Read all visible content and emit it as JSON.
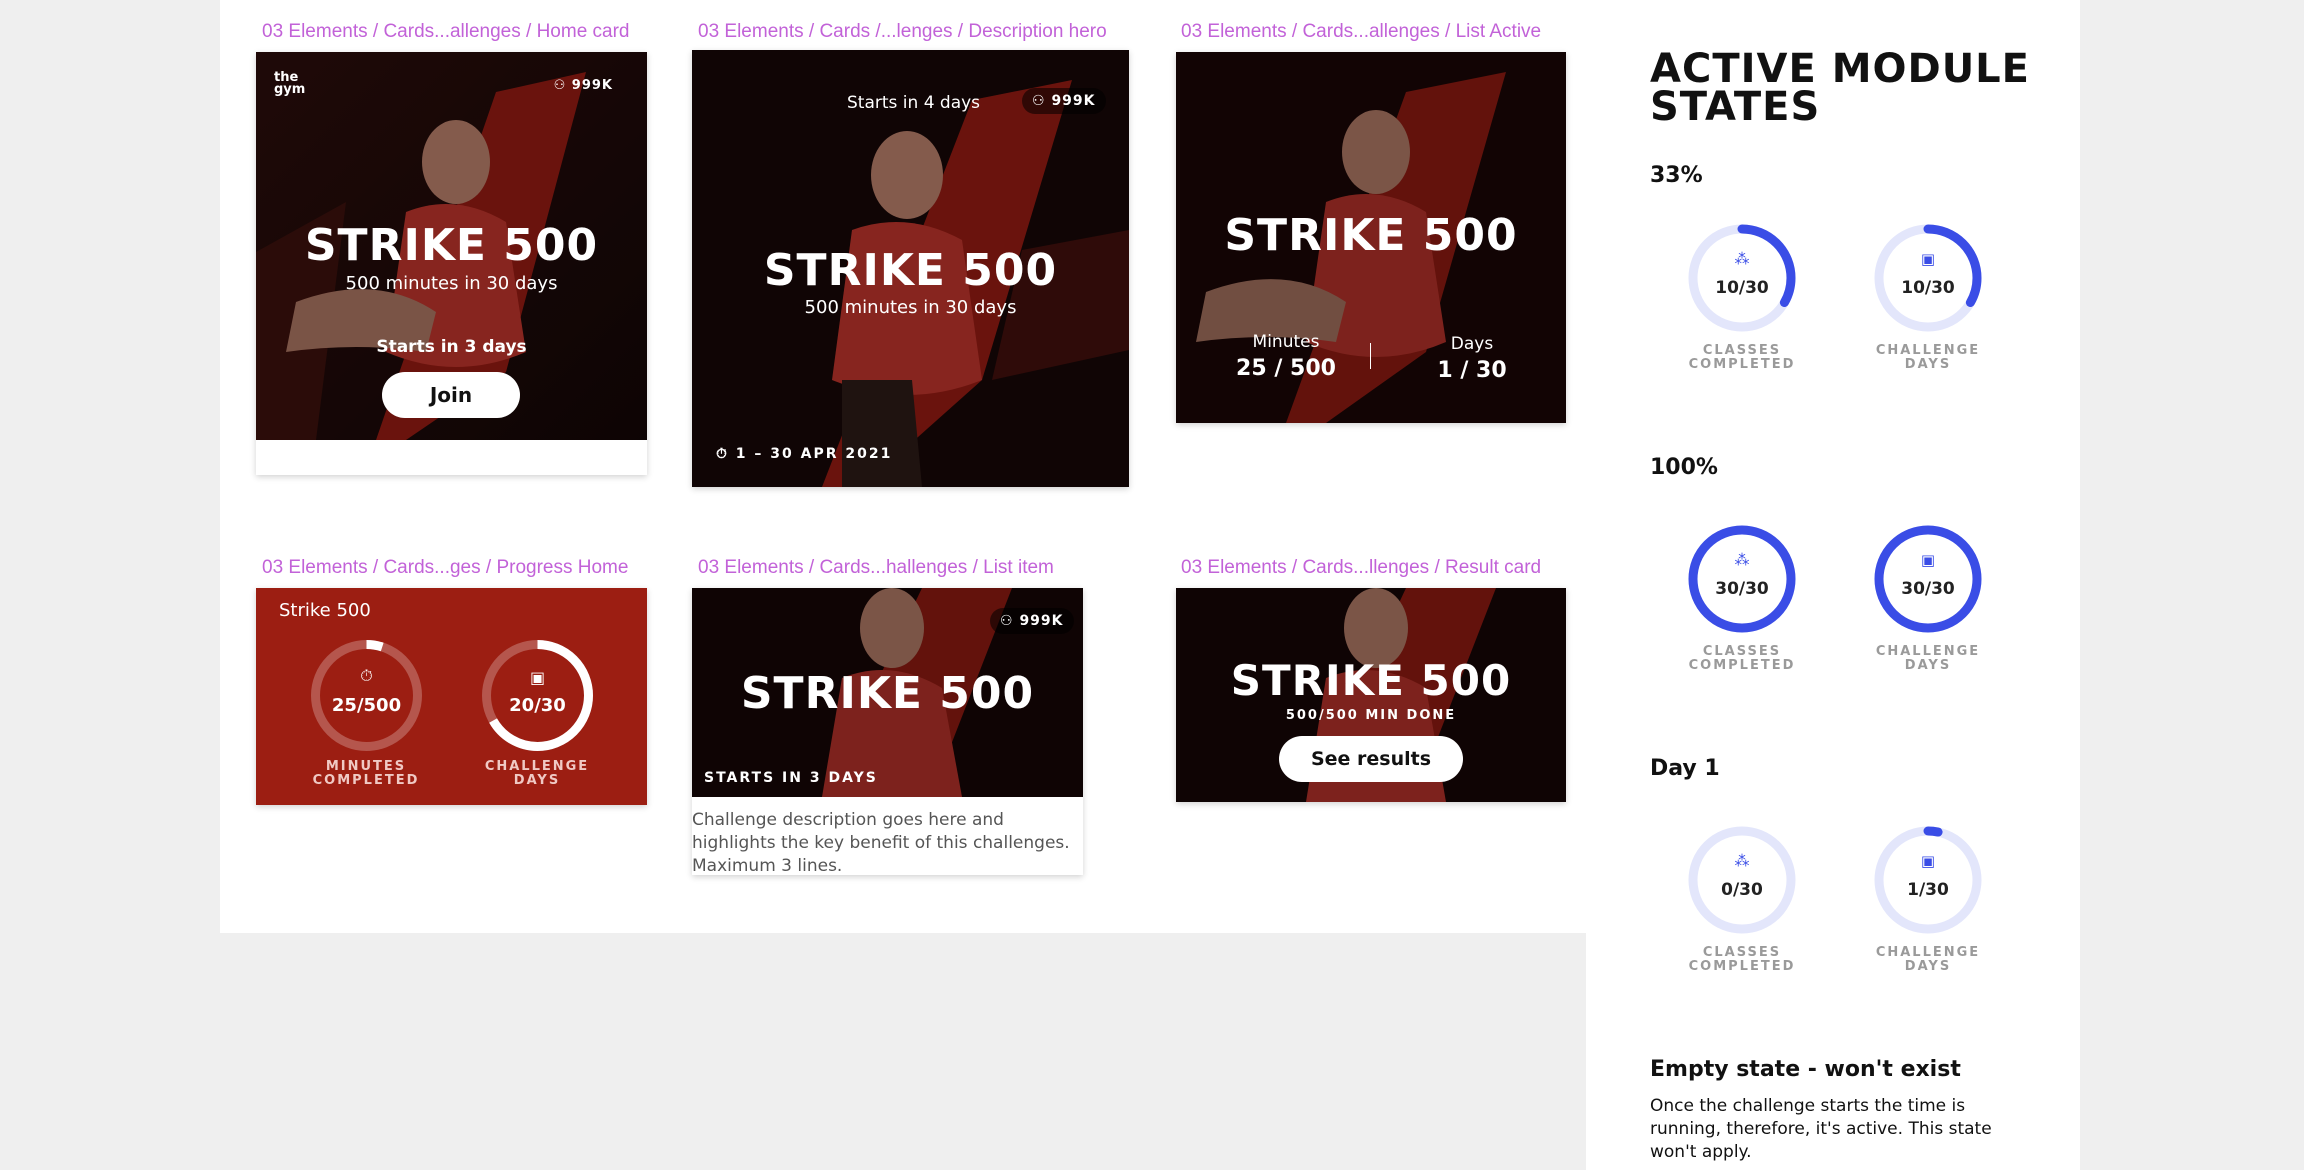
{
  "frames": {
    "home_card": "03 Elements / Cards...allenges / Home card",
    "description_hero": "03 Elements / Cards /...lenges / Description hero",
    "list_active": "03 Elements / Cards...allenges / List Active",
    "progress_home": "03 Elements / Cards...ges / Progress Home",
    "list_item": "03 Elements / Cards...hallenges / List item",
    "result_card": "03 Elements / Cards...llenges / Result card"
  },
  "colors": {
    "accent_purple": "#c262d8",
    "challenge_red": "#9c1e12",
    "ring_blue": "#3a4de6",
    "ring_track": "#e3e6fb"
  },
  "home_card": {
    "logo": "the gym",
    "participants": "999K",
    "title": "STRIKE 500",
    "subtitle": "500 minutes in 30 days",
    "starts": "Starts in 3 days",
    "join": "Join"
  },
  "description_hero": {
    "starts": "Starts in 4 days",
    "participants": "999K",
    "title": "STRIKE 500",
    "subtitle": "500 minutes in 30 days",
    "dates": "1 – 30 APR 2021"
  },
  "list_active": {
    "title": "STRIKE 500",
    "minutes_label": "Minutes",
    "minutes_value": "25 / 500",
    "days_label": "Days",
    "days_value": "1 / 30"
  },
  "progress_home": {
    "name": "Strike 500",
    "minutes_value": "25/500",
    "minutes_progress": 0.05,
    "minutes_label_1": "MINUTES",
    "minutes_label_2": "COMPLETED",
    "days_value": "20/30",
    "days_progress": 0.667,
    "days_label_1": "CHALLENGE",
    "days_label_2": "DAYS"
  },
  "list_item": {
    "participants": "999K",
    "title": "STRIKE 500",
    "starts": "STARTS IN 3 DAYS",
    "description": "Challenge description goes here and highlights the key benefit of this challenges. Maximum 3 lines."
  },
  "result_card": {
    "title": "STRIKE 500",
    "done": "500/500 MIN DONE",
    "button": "See results"
  },
  "panel": {
    "heading": "ACTIVE MODULE STATES",
    "states": [
      {
        "title": "33%",
        "classes": "10/30",
        "classes_progress": 0.333,
        "days": "10/30",
        "days_progress": 0.333
      },
      {
        "title": "100%",
        "classes": "30/30",
        "classes_progress": 1.0,
        "days": "30/30",
        "days_progress": 1.0
      },
      {
        "title": "Day 1",
        "classes": "0/30",
        "classes_progress": 0.0,
        "days": "1/30",
        "days_progress": 0.033
      }
    ],
    "classes_label_1": "CLASSES",
    "classes_label_2": "COMPLETED",
    "days_label_1": "CHALLENGE",
    "days_label_2": "DAYS",
    "empty_title": "Empty state - won't exist",
    "empty_body": "Once the challenge starts the time is running, therefore, it's active. This state won't apply."
  }
}
